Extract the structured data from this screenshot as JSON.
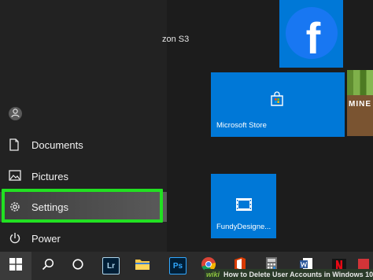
{
  "start_menu": {
    "items": [
      {
        "key": "documents",
        "label": "Documents",
        "icon": "document-icon"
      },
      {
        "key": "pictures",
        "label": "Pictures",
        "icon": "pictures-icon"
      },
      {
        "key": "settings",
        "label": "Settings",
        "icon": "gear-icon"
      },
      {
        "key": "power",
        "label": "Power",
        "icon": "power-icon"
      }
    ],
    "partial_app_text": "zon S3",
    "highlight_color": "#22e022"
  },
  "tiles": {
    "microsoft_store": {
      "label": "Microsoft Store"
    },
    "fundy": {
      "label": "FundyDesigne..."
    },
    "facebook": {
      "glyph": "f"
    },
    "minecraft": {
      "text": "MINE"
    },
    "accent_color": "#0078d7"
  },
  "taskbar": {
    "lightroom_label": "Lr",
    "photoshop_label": "Ps"
  },
  "caption": {
    "wiki": "wiki",
    "text": "How to Delete User Accounts in Windows 10"
  }
}
